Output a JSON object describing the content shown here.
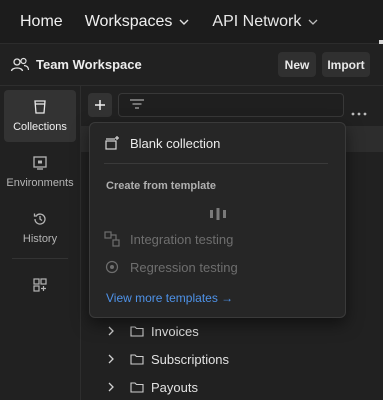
{
  "topnav": {
    "home": "Home",
    "workspaces": "Workspaces",
    "api_network": "API Network"
  },
  "workspace": {
    "title": "Team Workspace",
    "new_label": "New",
    "import_label": "Import"
  },
  "rail": {
    "items": [
      {
        "label": "Collections",
        "icon": "collections-icon"
      },
      {
        "label": "Environments",
        "icon": "environments-icon"
      },
      {
        "label": "History",
        "icon": "history-icon"
      },
      {
        "label": "",
        "icon": "configure-workbench-icon"
      }
    ]
  },
  "dropdown": {
    "blank_collection": "Blank collection",
    "create_from_template": "Create from template",
    "templates": [
      {
        "label": "Integration testing",
        "icon": "integration-icon"
      },
      {
        "label": "Regression testing",
        "icon": "regression-icon"
      }
    ],
    "view_more": "View more templates →"
  },
  "tree": {
    "folders": [
      "Invoices",
      "Subscriptions",
      "Payouts"
    ]
  },
  "colors": {
    "background": "#212121",
    "accent_link": "#4e92e8",
    "active_rail": "#333333"
  }
}
